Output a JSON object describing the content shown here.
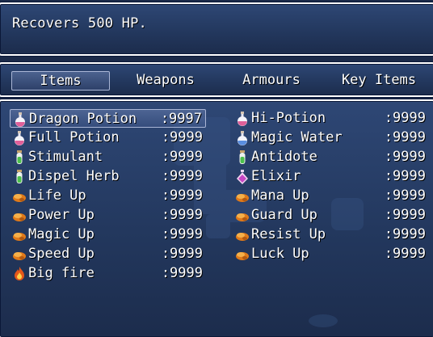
{
  "help": {
    "text": "Recovers 500 HP."
  },
  "tabs": [
    {
      "label": "Items",
      "selected": true
    },
    {
      "label": "Weapons",
      "selected": false
    },
    {
      "label": "Armours",
      "selected": false
    },
    {
      "label": "Key Items",
      "selected": false
    }
  ],
  "items": [
    {
      "name": "Dragon Potion",
      "qty": ":9997",
      "icon": "potion-pink-icon",
      "selected": true
    },
    {
      "name": "Hi-Potion",
      "qty": ":9999",
      "icon": "potion-pink-icon"
    },
    {
      "name": "Full Potion",
      "qty": ":9999",
      "icon": "potion-pink-icon"
    },
    {
      "name": "Magic Water",
      "qty": ":9999",
      "icon": "potion-blue-icon"
    },
    {
      "name": "Stimulant",
      "qty": ":9999",
      "icon": "vial-green-icon"
    },
    {
      "name": "Antidote",
      "qty": ":9999",
      "icon": "vial-green-icon"
    },
    {
      "name": "Dispel Herb",
      "qty": ":9999",
      "icon": "vial-green-icon"
    },
    {
      "name": "Elixir",
      "qty": ":9999",
      "icon": "flask-magenta-icon"
    },
    {
      "name": "Life Up",
      "qty": ":9999",
      "icon": "seed-orange-icon"
    },
    {
      "name": "Mana Up",
      "qty": ":9999",
      "icon": "seed-orange-icon"
    },
    {
      "name": "Power Up",
      "qty": ":9999",
      "icon": "seed-orange-icon"
    },
    {
      "name": "Guard Up",
      "qty": ":9999",
      "icon": "seed-orange-icon"
    },
    {
      "name": "Magic Up",
      "qty": ":9999",
      "icon": "seed-orange-icon"
    },
    {
      "name": "Resist Up",
      "qty": ":9999",
      "icon": "seed-orange-icon"
    },
    {
      "name": "Speed Up",
      "qty": ":9999",
      "icon": "seed-orange-icon"
    },
    {
      "name": "Luck Up",
      "qty": ":9999",
      "icon": "seed-orange-icon"
    },
    {
      "name": "Big fire",
      "qty": ":9999",
      "icon": "fire-icon"
    }
  ],
  "colors": {
    "window_top": "#2e4775",
    "window_bottom": "#1c2c4c",
    "border": "#ffffff",
    "cursor": "#aab6d6"
  }
}
